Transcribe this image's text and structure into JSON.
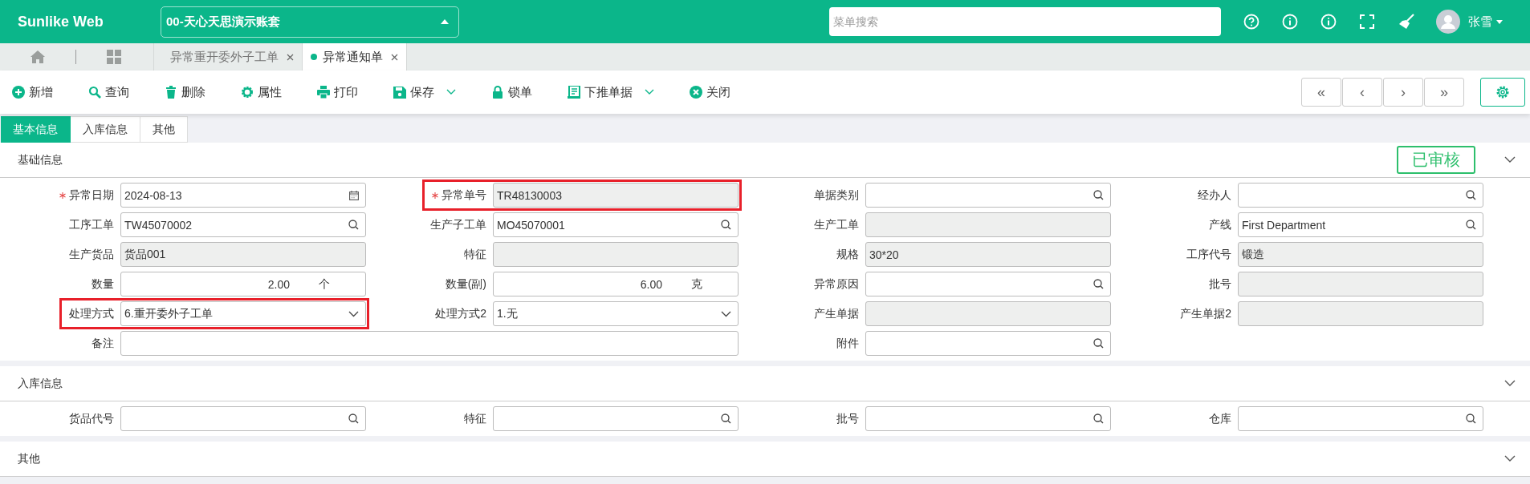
{
  "header": {
    "logo": "Sunlike Web",
    "account": "00-天心天思演示账套",
    "search": {
      "placeholder": "菜单搜索"
    },
    "user": "张雪"
  },
  "doc_tabs": [
    {
      "label": "异常重开委外子工单",
      "selected": false
    },
    {
      "label": "异常通知单",
      "selected": true
    }
  ],
  "toolbar": [
    {
      "label": "新增",
      "kind": "plus",
      "dropdown": false
    },
    {
      "label": "查询",
      "kind": "search",
      "dropdown": false
    },
    {
      "label": "删除",
      "kind": "trash",
      "dropdown": false
    },
    {
      "label": "属性",
      "kind": "gear",
      "dropdown": false
    },
    {
      "label": "打印",
      "kind": "printer",
      "dropdown": false
    },
    {
      "label": "保存",
      "kind": "save",
      "dropdown": true
    },
    {
      "label": "锁单",
      "kind": "lock",
      "dropdown": false
    },
    {
      "label": "下推单据",
      "kind": "document",
      "dropdown": true
    },
    {
      "label": "关闭",
      "kind": "close",
      "dropdown": false
    }
  ],
  "nav_buttons": [
    "«",
    "‹",
    "›",
    "»"
  ],
  "sub_tabs": [
    {
      "label": "基本信息",
      "selected": true
    },
    {
      "label": "入库信息",
      "selected": false
    },
    {
      "label": "其他",
      "selected": false
    }
  ],
  "sections": [
    {
      "title": "基础信息",
      "status": "已审核",
      "fields": [
        {
          "label": "异常日期",
          "kind": "date",
          "value": "2024-08-13",
          "required": true,
          "highlighted": false,
          "wide": false
        },
        {
          "label": "异常单号",
          "kind": "readonly",
          "value": "TR48130003",
          "required": true,
          "highlighted": true,
          "wide": false
        },
        {
          "label": "单据类别",
          "kind": "lookup",
          "required": false,
          "highlighted": false,
          "wide": false
        },
        {
          "label": "经办人",
          "kind": "lookup",
          "required": false,
          "highlighted": false,
          "wide": false
        },
        {
          "label": "工序工单",
          "kind": "lookup",
          "value": "TW45070002",
          "required": false,
          "highlighted": false,
          "wide": false
        },
        {
          "label": "生产子工单",
          "kind": "lookup",
          "value": "MO45070001",
          "required": false,
          "highlighted": false,
          "wide": false
        },
        {
          "label": "生产工单",
          "kind": "readonly",
          "required": false,
          "highlighted": false,
          "wide": false
        },
        {
          "label": "产线",
          "kind": "lookup",
          "value": "First Department",
          "required": false,
          "highlighted": false,
          "wide": false
        },
        {
          "label": "生产货品",
          "kind": "readonly",
          "value": "货品001",
          "required": false,
          "highlighted": false,
          "wide": false
        },
        {
          "label": "特征",
          "kind": "readonly",
          "required": false,
          "highlighted": false,
          "wide": false
        },
        {
          "label": "规格",
          "kind": "readonly",
          "value": "30*20",
          "required": false,
          "highlighted": false,
          "wide": false
        },
        {
          "label": "工序代号",
          "kind": "readonly",
          "value": "锻造",
          "required": false,
          "highlighted": false,
          "wide": false
        },
        {
          "label": "数量",
          "kind": "number",
          "value": "2.00",
          "unit": "个",
          "required": false,
          "highlighted": false,
          "wide": false
        },
        {
          "label": "数量(副)",
          "kind": "number",
          "value": "6.00",
          "unit": "克",
          "required": false,
          "highlighted": false,
          "wide": false
        },
        {
          "label": "异常原因",
          "kind": "lookup",
          "required": false,
          "highlighted": false,
          "wide": false
        },
        {
          "label": "批号",
          "kind": "readonly",
          "required": false,
          "highlighted": false,
          "wide": false
        },
        {
          "label": "处理方式",
          "kind": "select",
          "value": "6.重开委外子工单",
          "required": false,
          "highlighted": true,
          "wide": false
        },
        {
          "label": "处理方式2",
          "kind": "select",
          "value": "1.无",
          "required": false,
          "highlighted": false,
          "wide": false
        },
        {
          "label": "产生单据",
          "kind": "readonly",
          "required": false,
          "highlighted": false,
          "wide": false
        },
        {
          "label": "产生单据2",
          "kind": "readonly",
          "required": false,
          "highlighted": false,
          "wide": false
        },
        {
          "label": "备注",
          "kind": "text",
          "required": false,
          "highlighted": false,
          "wide": true
        },
        {
          "label": "附件",
          "kind": "lookup",
          "required": false,
          "highlighted": false,
          "wide": false
        }
      ]
    },
    {
      "title": "入库信息",
      "fields": [
        {
          "label": "货品代号",
          "kind": "lookup",
          "required": false,
          "highlighted": false,
          "wide": false
        },
        {
          "label": "特征",
          "kind": "lookup",
          "required": false,
          "highlighted": false,
          "wide": false
        },
        {
          "label": "批号",
          "kind": "lookup",
          "required": false,
          "highlighted": false,
          "wide": false
        },
        {
          "label": "仓库",
          "kind": "lookup",
          "required": false,
          "highlighted": false,
          "wide": false
        }
      ]
    },
    {
      "title": "其他"
    }
  ]
}
